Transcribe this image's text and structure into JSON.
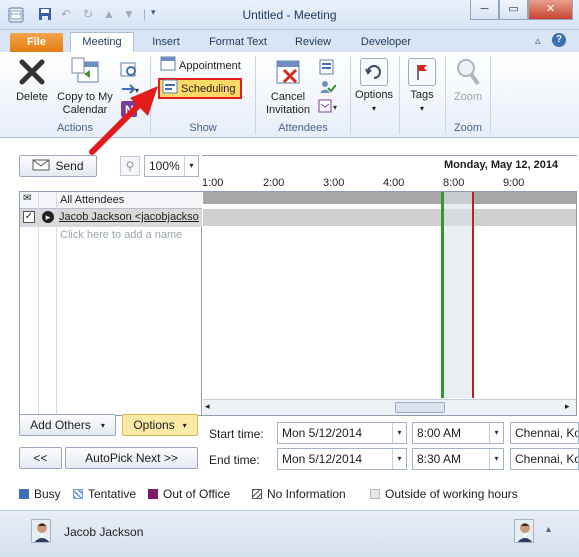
{
  "window": {
    "title": "Untitled - Meeting",
    "minimize": "─",
    "restore": "▭",
    "close": "✕"
  },
  "tabs": [
    {
      "label": "File"
    },
    {
      "label": "Meeting"
    },
    {
      "label": "Insert"
    },
    {
      "label": "Format Text"
    },
    {
      "label": "Review"
    },
    {
      "label": "Developer"
    }
  ],
  "ribbon": {
    "actions": {
      "delete": "Delete",
      "copy_line1": "Copy to My",
      "copy_line2": "Calendar",
      "label": "Actions"
    },
    "show": {
      "appointment": "Appointment",
      "scheduling": "Scheduling",
      "label": "Show"
    },
    "attendees": {
      "cancel_line1": "Cancel",
      "cancel_line2": "Invitation",
      "label": "Attendees"
    },
    "options": {
      "label": "Options"
    },
    "tags": {
      "label": "Tags"
    },
    "zoom": {
      "btn": "Zoom",
      "label": "Zoom"
    }
  },
  "toolbar": {
    "send": "Send",
    "zoom_value": "100%"
  },
  "grid": {
    "day": "Monday, May 12, 2014",
    "times": [
      "1:00",
      "2:00",
      "3:00",
      "4:00",
      "8:00",
      "9:00"
    ],
    "header": "All Attendees",
    "attendee": "Jacob Jackson <jacobjackson",
    "add_placeholder": "Click here to add a name"
  },
  "controls": {
    "add_others": "Add Others",
    "options": "Options",
    "prev": "<<",
    "autopick": "AutoPick Next >>",
    "start_label": "Start time:",
    "end_label": "End time:",
    "start_date": "Mon 5/12/2014",
    "start_time": "8:00 AM",
    "end_date": "Mon 5/12/2014",
    "end_time": "8:30 AM",
    "timezone": "Chennai, Ko"
  },
  "legend": [
    {
      "label": "Busy",
      "color": "#3c6fb5"
    },
    {
      "label": "Tentative",
      "color": "#7aa0d8"
    },
    {
      "label": "Out of Office",
      "color": "#7a1a6a"
    },
    {
      "label": "No Information",
      "color": "#555555"
    },
    {
      "label": "Outside of working hours",
      "color": "#e5e5e5"
    }
  ],
  "footer": {
    "name": "Jacob Jackson"
  },
  "colors": {
    "accent_file": "#e57c12",
    "highlight": "#ffd966",
    "arrow": "#e21b1b"
  }
}
